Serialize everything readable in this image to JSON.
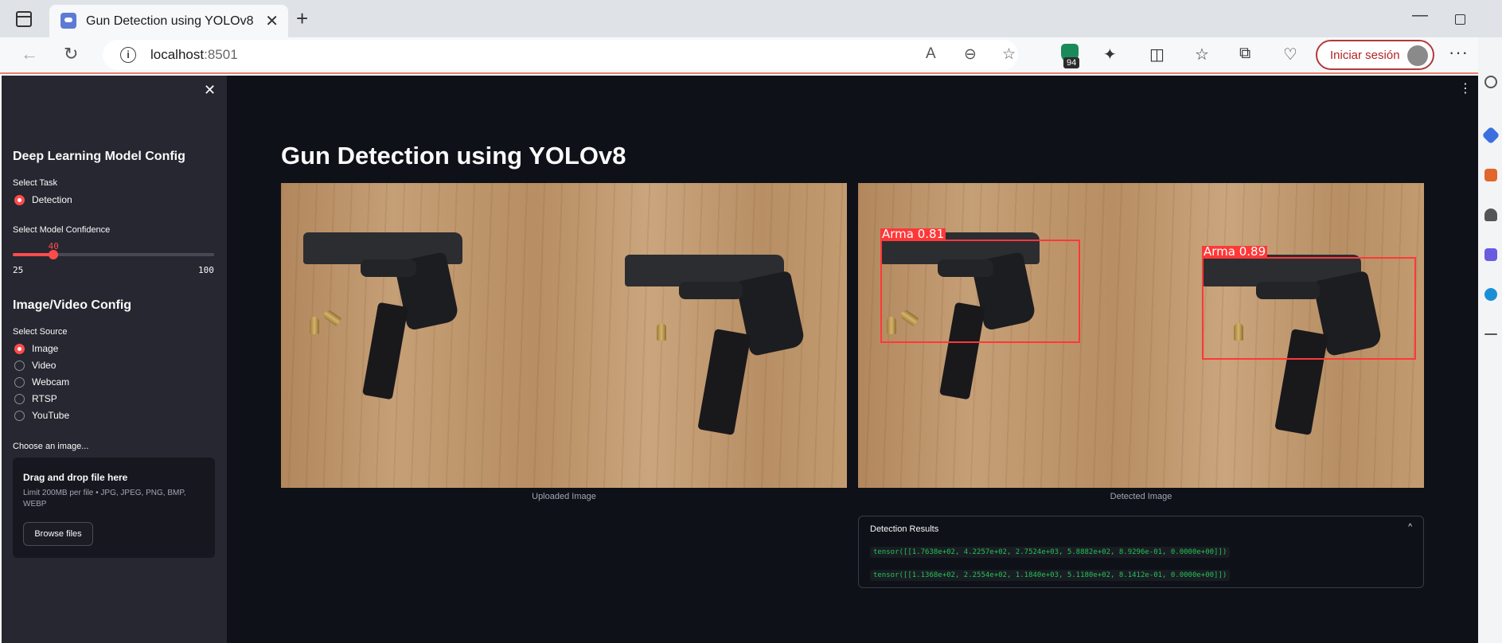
{
  "browser": {
    "tab_title": "Gun Detection using YOLOv8",
    "tab_close": "✕",
    "new_tab": "+",
    "url_host": "localhost",
    "url_port": ":8501",
    "extension_badge": "94",
    "signin_label": "Iniciar sesión",
    "menu_dots": "···"
  },
  "sidebar": {
    "close_glyph": "✕",
    "model_header": "Deep Learning Model Config",
    "task_label": "Select Task",
    "task_options": [
      "Detection"
    ],
    "task_selected": "Detection",
    "confidence_label": "Select Model Confidence",
    "confidence": {
      "value": 40,
      "min": 25,
      "max": 100
    },
    "io_header": "Image/Video Config",
    "source_label": "Select Source",
    "source_options": [
      "Image",
      "Video",
      "Webcam",
      "RTSP",
      "YouTube"
    ],
    "source_selected": "Image",
    "uploader_label": "Choose an image...",
    "uploader": {
      "title": "Drag and drop file here",
      "limit": "Limit 200MB per file • JPG, JPEG, PNG, BMP, WEBP",
      "button": "Browse files"
    }
  },
  "main": {
    "menu_glyph": "⋮",
    "title": "Gun Detection using YOLOv8",
    "uploaded_caption": "Uploaded Image",
    "detected_caption": "Detected Image",
    "detections": [
      {
        "label": "Arma  0.81"
      },
      {
        "label": "Arma  0.89"
      }
    ],
    "results": {
      "title": "Detection Results",
      "chevron": "^",
      "lines": [
        "tensor([[1.7638e+02, 4.2257e+02, 2.7524e+03, 5.8882e+02, 8.9296e-01, 0.0000e+00]])",
        "tensor([[1.1368e+02, 2.2554e+02, 1.1840e+03, 5.1180e+02, 8.1412e-01, 0.0000e+00]])"
      ]
    }
  },
  "colors": {
    "accent": "#ff4b4b",
    "app_bg": "#0e1117",
    "sidebar_bg": "#262730",
    "box": "#ff3838",
    "code_text": "#21c354"
  }
}
